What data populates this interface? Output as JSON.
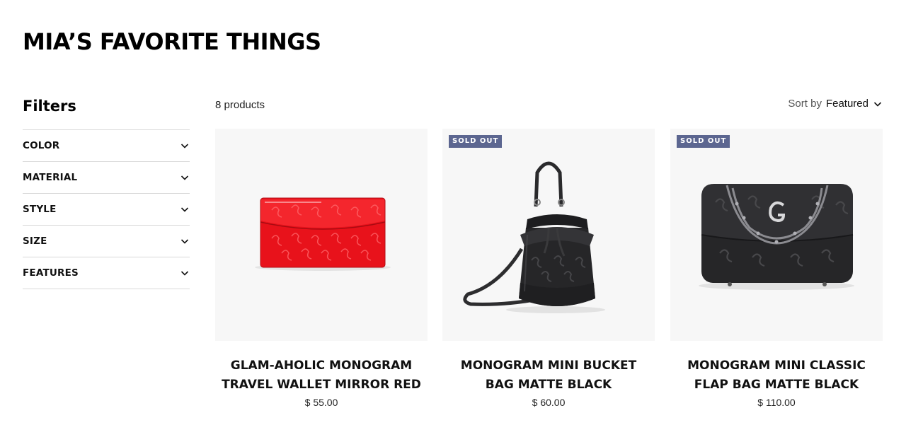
{
  "page": {
    "title": "MIA’S FAVORITE THINGS"
  },
  "filters": {
    "heading": "Filters",
    "items": [
      {
        "label": "COLOR"
      },
      {
        "label": "MATERIAL"
      },
      {
        "label": "STYLE"
      },
      {
        "label": "SIZE"
      },
      {
        "label": "FEATURES"
      }
    ]
  },
  "toolbar": {
    "product_count": "8 products",
    "sort_label": "Sort by",
    "sort_value": "Featured"
  },
  "products": [
    {
      "title": "GLAM-AHOLIC MONOGRAM TRAVEL WALLET MIRROR RED",
      "price": "$ 55.00",
      "badge": "",
      "image_icon": "red-wallet-image"
    },
    {
      "title": "MONOGRAM MINI BUCKET BAG MATTE BLACK",
      "price": "$ 60.00",
      "badge": "SOLD OUT",
      "image_icon": "black-bucket-bag-image"
    },
    {
      "title": "MONOGRAM MINI CLASSIC FLAP BAG MATTE BLACK",
      "price": "$ 110.00",
      "badge": "SOLD OUT",
      "image_icon": "black-flap-bag-image"
    }
  ],
  "colors": {
    "badge": "#5c6690",
    "wallet_red": "#e8121b",
    "bag_black": "#262628"
  }
}
